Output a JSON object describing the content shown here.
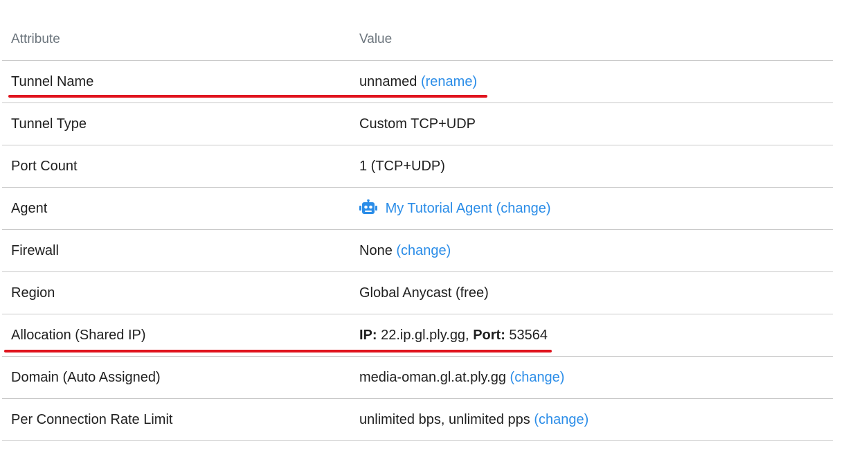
{
  "table": {
    "header": {
      "attribute": "Attribute",
      "value": "Value"
    },
    "rows": [
      {
        "attribute": "Tunnel Name",
        "value": "unnamed",
        "link": "(rename)"
      },
      {
        "attribute": "Tunnel Type",
        "value": "Custom TCP+UDP"
      },
      {
        "attribute": "Port Count",
        "value": "1 (TCP+UDP)"
      },
      {
        "attribute": "Agent",
        "value_link": "My Tutorial Agent (change)",
        "icon": "robot-icon"
      },
      {
        "attribute": "Firewall",
        "value": "None",
        "link": "(change)"
      },
      {
        "attribute": "Region",
        "value": "Global Anycast (free)"
      },
      {
        "attribute": "Allocation (Shared IP)",
        "ip_label": "IP:",
        "ip_value": "22.ip.gl.ply.gg,",
        "port_label": "Port:",
        "port_value": "53564"
      },
      {
        "attribute": "Domain (Auto Assigned)",
        "value": "media-oman.gl.at.ply.gg",
        "link": "(change)"
      },
      {
        "attribute": "Per Connection Rate Limit",
        "value": "unlimited bps, unlimited pps",
        "link": "(change)"
      }
    ]
  },
  "colors": {
    "link": "#2b8de8",
    "highlight_underline": "#e0141e",
    "header_text": "#6c757d",
    "divider": "#c8c8c8"
  }
}
